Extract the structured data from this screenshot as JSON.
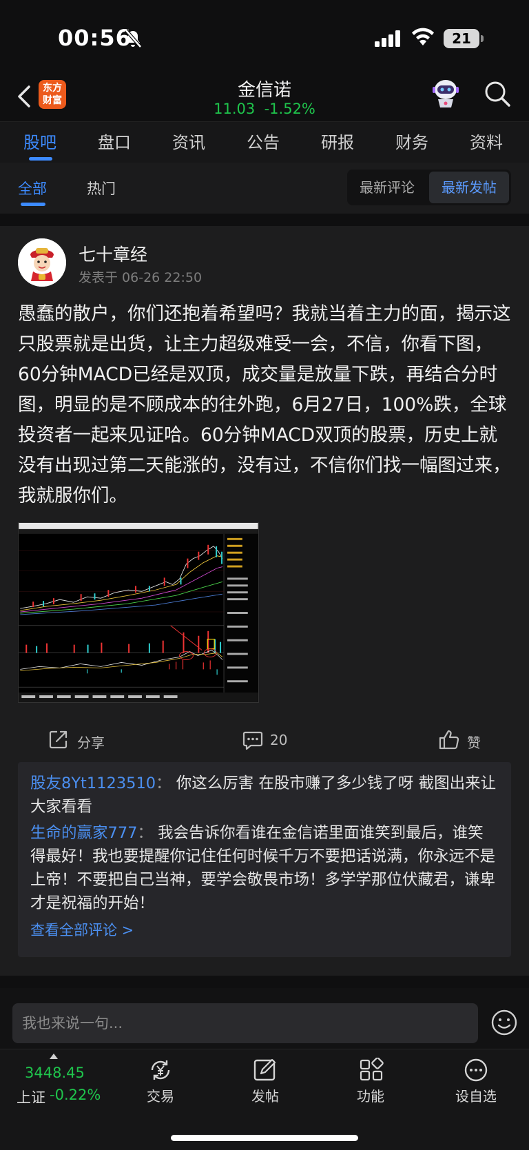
{
  "status_bar": {
    "time": "00:56",
    "battery": "21"
  },
  "header": {
    "logo_line1": "东方",
    "logo_line2": "财富",
    "stock_name": "金信诺",
    "stock_price": "11.03",
    "stock_change": "-1.52%",
    "price_color": "#1fc44c"
  },
  "tabs": [
    {
      "label": "股吧",
      "active": true
    },
    {
      "label": "盘口"
    },
    {
      "label": "资讯"
    },
    {
      "label": "公告"
    },
    {
      "label": "研报"
    },
    {
      "label": "财务"
    },
    {
      "label": "资料"
    }
  ],
  "subtabs": {
    "all": "全部",
    "hot": "热门",
    "latest_comment": "最新评论",
    "latest_post": "最新发帖"
  },
  "post": {
    "author": "七十章经",
    "time": "发表于 06-26 22:50",
    "body": "愚蠢的散户，你们还抱着希望吗？我就当着主力的面，揭示这只股票就是出货，让主力超级难受一会，不信，你看下图，60分钟MACD已经是双顶，成交量是放量下跌，再结合分时图，明显的是不顾成本的往外跑，6月27日，100%跌，全球投资者一起来见证哈。60分钟MACD双顶的股票，历史上就没有出现过第二天能涨的，没有过，不信你们找一幅图过来，我就服你们。",
    "share_label": "分享",
    "comment_count": "20",
    "like_label": "赞"
  },
  "comments": [
    {
      "user": "股友8Yt1123510",
      "text": "你这么厉害 在股市赚了多少钱了呀 截图出来让大家看看"
    },
    {
      "user": "生命的赢家777",
      "text": "我会告诉你看谁在金信诺里面谁笑到最后，谁笑得最好！我也要提醒你记住任何时候千万不要把话说满，你永远不是上帝！不要把自己当神，要学会敬畏市场！多学学那位伏藏君，谦卑才是祝福的开始！"
    }
  ],
  "view_all_comments": "查看全部评论 >",
  "input_placeholder": "我也来说一句...",
  "bottom_nav": {
    "index_value": "3448.45",
    "index_name": "上证",
    "index_change": "-0.22%",
    "items": [
      {
        "label": "交易",
        "icon": "trade-icon"
      },
      {
        "label": "发帖",
        "icon": "post-icon"
      },
      {
        "label": "功能",
        "icon": "apps-icon"
      },
      {
        "label": "设自选",
        "icon": "watchlist-icon"
      }
    ]
  }
}
